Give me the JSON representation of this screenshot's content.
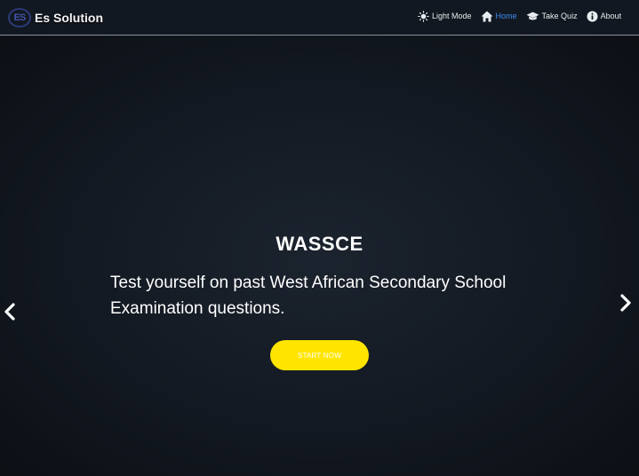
{
  "brand": {
    "logo_text": "ES",
    "name": "Es Solution"
  },
  "nav": {
    "light_mode": "Light Mode",
    "home": "Home",
    "take_quiz": "Take Quiz",
    "about": "About"
  },
  "hero": {
    "title": "WASSCE",
    "description": "Test yourself on past West African Secondary School Examination questions.",
    "cta_label": "START NOW"
  },
  "icons": {
    "light_mode": "sun-icon",
    "home": "home-icon",
    "take_quiz": "graduation-cap-icon",
    "about": "info-icon",
    "prev": "chevron-left-icon",
    "next": "chevron-right-icon"
  },
  "colors": {
    "accent_active": "#3c8df2",
    "cta_background": "#ffe500",
    "navbar_background": "#121821",
    "hero_background": "#131922"
  }
}
